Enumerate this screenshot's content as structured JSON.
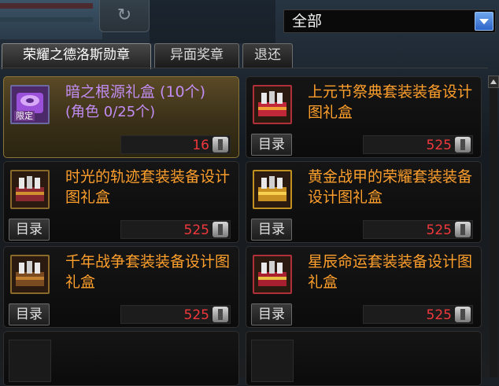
{
  "header": {
    "filter_value": "全部"
  },
  "tabs": [
    {
      "label": "荣耀之德洛斯勋章",
      "active": true
    },
    {
      "label": "异面奖章",
      "active": false
    },
    {
      "label": "退还",
      "active": false
    }
  ],
  "items": [
    {
      "name": "暗之根源礼盒 (10个)",
      "sub": "(角色 0/25个)",
      "price": "16",
      "limit": "限定",
      "selected": true
    },
    {
      "name": "上元节祭典套装装备设计图礼盒",
      "price": "525",
      "catalog": "目录"
    },
    {
      "name": "时光的轨迹套装装备设计图礼盒",
      "price": "525",
      "catalog": "目录"
    },
    {
      "name": "黄金战甲的荣耀套装装备设计图礼盒",
      "price": "525",
      "catalog": "目录"
    },
    {
      "name": "千年战争套装装备设计图礼盒",
      "price": "525",
      "catalog": "目录"
    },
    {
      "name": "星辰命运套装装备设计图礼盒",
      "price": "525",
      "catalog": "目录"
    }
  ],
  "colors": {
    "item_name": "#ff9f2c",
    "limited_name": "#c18cf3",
    "price": "#f0383c",
    "selected_bg": "#5a4a26"
  }
}
